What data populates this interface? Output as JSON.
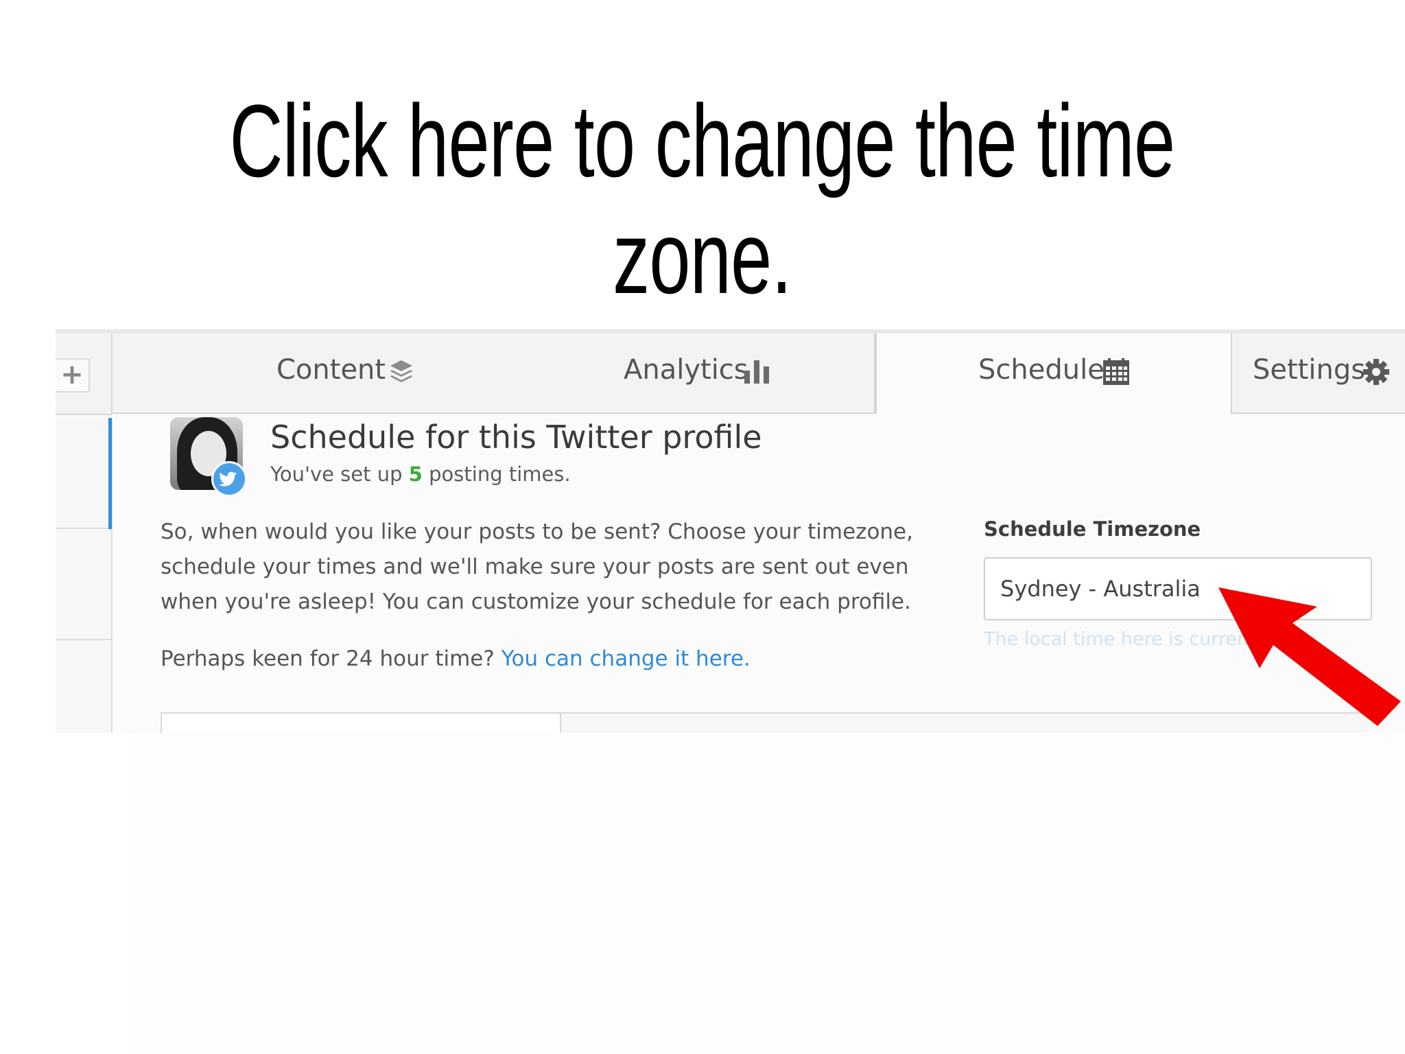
{
  "headline": "Click here to change the time zone.",
  "tabs": {
    "add": "+",
    "content": "Content",
    "analytics": "Analytics",
    "schedule": "Schedule",
    "settings": "Settings"
  },
  "profile": {
    "title": "Schedule for this Twitter profile",
    "sub_prefix": "You've set up ",
    "posting_count": "5",
    "sub_suffix": " posting times."
  },
  "intro_text": "So, when would you like your posts to be sent? Choose your timezone, schedule your times and we'll make sure your posts are sent out even when you're asleep! You can customize your schedule for each profile.",
  "hour_prefix": "Perhaps keen for 24 hour time? ",
  "hour_link": "You can change it here.",
  "timezone": {
    "label": "Schedule Timezone",
    "value": "Sydney - Australia",
    "local_time_text": "The local time here is current"
  },
  "colors": {
    "accent_blue": "#2d8fdd",
    "link_blue": "#2e8bd6",
    "count_green": "#3bab3b",
    "arrow_red": "#f20000",
    "twitter_blue": "#4ba1e8"
  }
}
